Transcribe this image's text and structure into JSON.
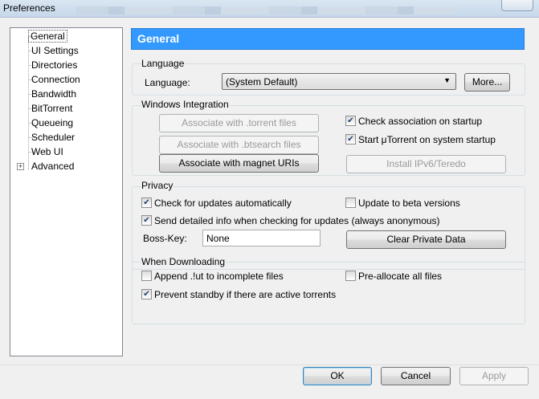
{
  "window": {
    "title": "Preferences"
  },
  "tree": {
    "items": [
      {
        "label": "General"
      },
      {
        "label": "UI Settings"
      },
      {
        "label": "Directories"
      },
      {
        "label": "Connection"
      },
      {
        "label": "Bandwidth"
      },
      {
        "label": "BitTorrent"
      },
      {
        "label": "Queueing"
      },
      {
        "label": "Scheduler"
      },
      {
        "label": "Web UI"
      },
      {
        "label": "Advanced"
      }
    ],
    "expander_symbol": "+"
  },
  "header": {
    "title": "General"
  },
  "language": {
    "group_label": "Language",
    "field_label": "Language:",
    "selected": "(System Default)",
    "more_button": "More..."
  },
  "windows_integration": {
    "group_label": "Windows Integration",
    "assoc_torrent": "Associate with .torrent files",
    "assoc_btsearch": "Associate with .btsearch files",
    "assoc_magnet": "Associate with magnet URIs",
    "check_assoc_label": "Check association on startup",
    "check_assoc_checked": true,
    "start_label": "Start μTorrent on system startup",
    "start_checked": true,
    "install_ipv6": "Install IPv6/Teredo"
  },
  "privacy": {
    "group_label": "Privacy",
    "check_updates_label": "Check for updates automatically",
    "check_updates_checked": true,
    "beta_label": "Update to beta versions",
    "beta_checked": false,
    "send_info_label": "Send detailed info when checking for updates (always anonymous)",
    "send_info_checked": true,
    "boss_key_label": "Boss-Key:",
    "boss_key_value": "None",
    "clear_private": "Clear Private Data"
  },
  "when_downloading": {
    "group_label": "When Downloading",
    "append_label": "Append .!ut to incomplete files",
    "append_checked": false,
    "preallocate_label": "Pre-allocate all files",
    "preallocate_checked": false,
    "prevent_standby_label": "Prevent standby if there are active torrents",
    "prevent_standby_checked": true
  },
  "footer": {
    "ok": "OK",
    "cancel": "Cancel",
    "apply": "Apply"
  },
  "colors": {
    "header_bg": "#3399ff",
    "header_text": "#ffffff",
    "disabled_text": "#9a9a9a"
  }
}
